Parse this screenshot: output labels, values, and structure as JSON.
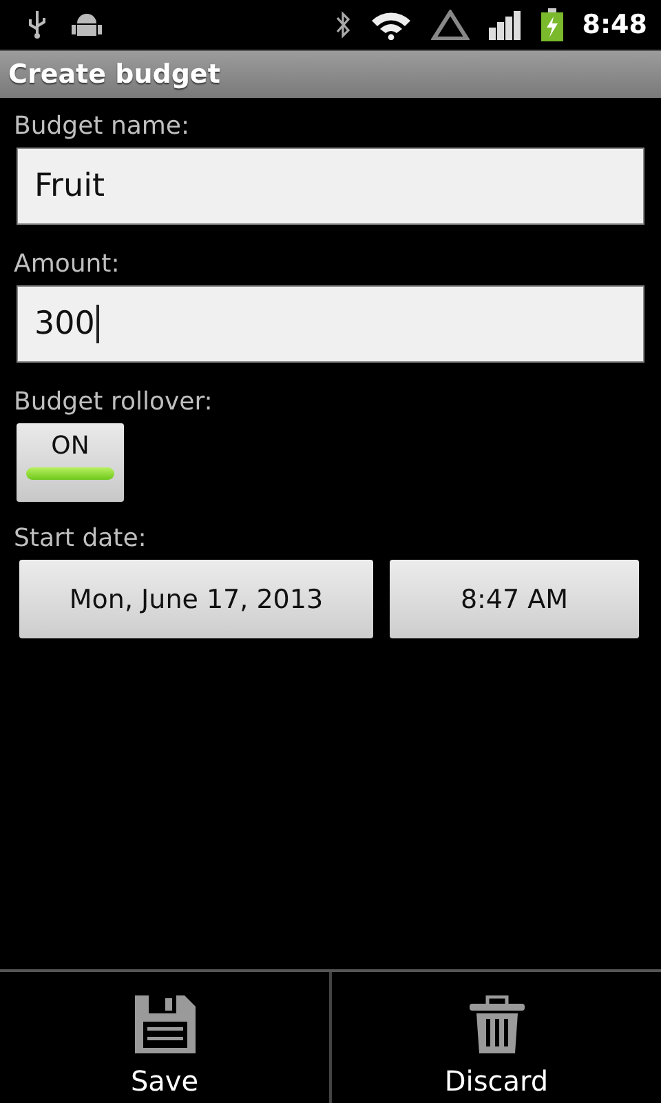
{
  "status_bar": {
    "time": "8:48"
  },
  "title_bar": {
    "title": "Create budget"
  },
  "form": [
    {
      "kind": "text",
      "label": "Budget name:",
      "value": "Fruit",
      "focused": false
    },
    {
      "kind": "text",
      "label": "Amount:",
      "value": "300",
      "focused": true
    },
    {
      "kind": "toggle",
      "label": "Budget rollover:",
      "text": "ON",
      "on": true
    },
    {
      "kind": "datetime",
      "label": "Start date:",
      "date": "Mon, June 17, 2013",
      "time": "8:47 AM"
    }
  ],
  "bottom_bar": [
    {
      "kind": "save",
      "label": "Save"
    },
    {
      "kind": "discard",
      "label": "Discard"
    }
  ]
}
